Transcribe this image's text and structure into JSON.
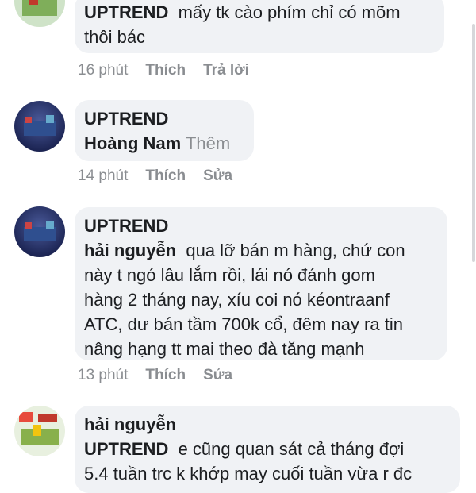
{
  "comments": [
    {
      "tag": "UPTREND",
      "text": "mấy tk cào phím chỉ có mõm",
      "text2": "thôi bác",
      "time": "16 phút",
      "like": "Thích",
      "action": "Trả lời"
    },
    {
      "author": "UPTREND",
      "mention": "Hoàng Nam",
      "extra": "Thêm",
      "time": "14 phút",
      "like": "Thích",
      "action": "Sửa"
    },
    {
      "author": "UPTREND",
      "mention": "hải nguyễn",
      "lines": [
        "qua lỡ bán m hàng, chứ con",
        "này t ngó lâu lắm rồi, lái nó đánh gom",
        "hàng 2 tháng nay, xíu coi nó kéontraanf",
        "ATC, dư bán tầm 700k cổ, đêm nay ra tin",
        "nâng hạng tt mai theo đà tăng mạnh"
      ],
      "time": "13 phút",
      "like": "Thích",
      "action": "Sửa"
    },
    {
      "author": "hải nguyễn",
      "mention": "UPTREND",
      "lines": [
        "e cũng quan sát cả tháng đợi",
        "5.4 tuần trc k khớp may cuối tuần vừa r đc"
      ]
    }
  ]
}
